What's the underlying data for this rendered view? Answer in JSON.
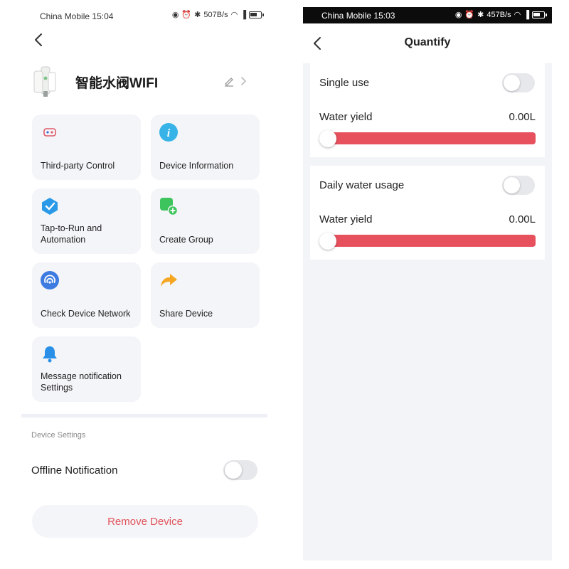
{
  "left_screen": {
    "status_bar": {
      "carrier": "China Mobile",
      "time": "15:04",
      "net_speed": "507B/s"
    },
    "device": {
      "name": "智能水阀WIFI"
    },
    "tiles": [
      {
        "label": "Third-party Control",
        "icon": "third-party-control-icon"
      },
      {
        "label": "Device Information",
        "icon": "info-icon"
      },
      {
        "label": "Tap-to-Run and Automation",
        "icon": "automation-check-icon"
      },
      {
        "label": "Create Group",
        "icon": "create-group-icon"
      },
      {
        "label": "Check Device Network",
        "icon": "network-icon"
      },
      {
        "label": "Share Device",
        "icon": "share-arrow-icon"
      },
      {
        "label": "Message notification Settings",
        "icon": "bell-icon"
      }
    ],
    "section_title": "Device Settings",
    "offline_notification": {
      "label": "Offline Notification",
      "enabled": false
    },
    "remove_button": "Remove Device"
  },
  "right_screen": {
    "status_bar": {
      "carrier": "China Mobile",
      "time": "15:03",
      "net_speed": "457B/s"
    },
    "title": "Quantify",
    "panels": [
      {
        "toggle_label": "Single use",
        "toggle_enabled": false,
        "yield_label": "Water yield",
        "yield_value": "0.00L",
        "slider_value": 0
      },
      {
        "toggle_label": "Daily water usage",
        "toggle_enabled": false,
        "yield_label": "Water yield",
        "yield_value": "0.00L",
        "slider_value": 0
      }
    ]
  },
  "colors": {
    "accent_red": "#e0535b",
    "slider_track": "#e7515e",
    "card_bg": "#f4f5f8",
    "status_bar_dark": "#0c0c0c"
  }
}
